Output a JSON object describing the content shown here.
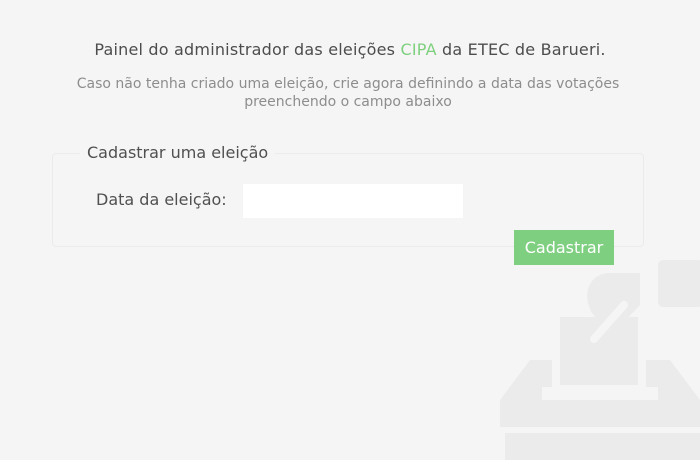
{
  "header": {
    "title_before": "Painel do administrador das eleições",
    "title_accent": "CIPA",
    "title_after": "da ETEC de Barueri.",
    "subtitle": "Caso não tenha criado uma eleição, crie agora definindo a data das votações preenchendo o campo abaixo"
  },
  "form": {
    "legend": "Cadastrar uma eleição",
    "date_label": "Data da eleição:",
    "date_value": "",
    "date_placeholder": "",
    "submit_label": "Cadastrar"
  },
  "decoration": {
    "icon": "ballot-box-icon"
  },
  "colors": {
    "accent": "#7ed07f",
    "background": "#f5f5f5",
    "button": "#7fcf80",
    "illustration": "#ebebeb"
  }
}
